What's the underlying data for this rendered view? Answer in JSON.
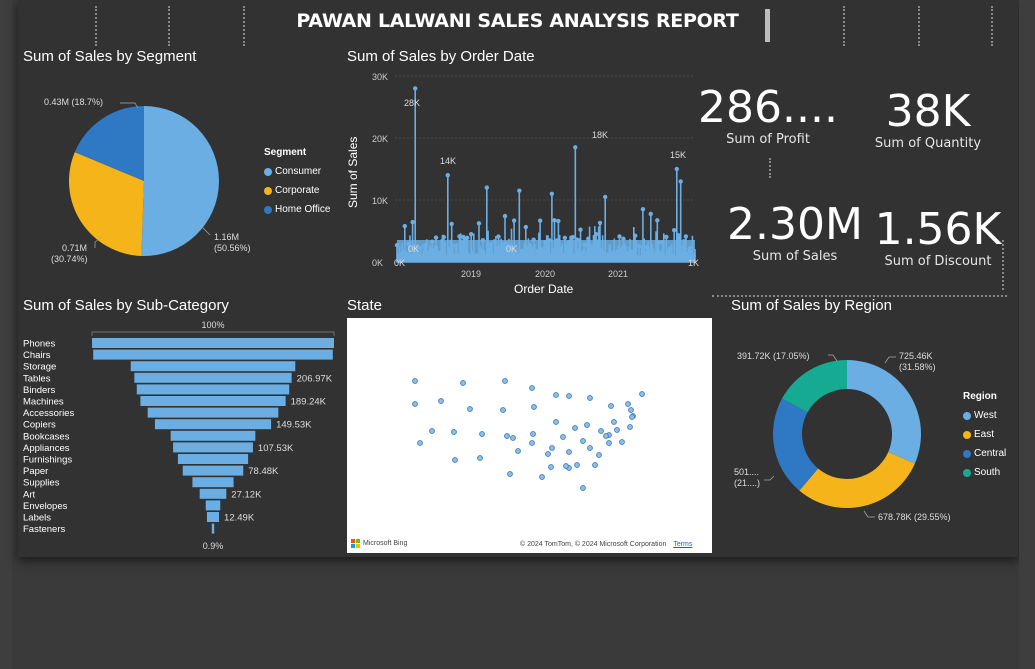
{
  "report": {
    "title": "PAWAN LALWANI SALES ANALYSIS REPORT"
  },
  "colors": {
    "west": "#6aaee3",
    "east": "#f5b51a",
    "central": "#2f78c4",
    "south": "#16aa93",
    "bar": "#6aaee3"
  },
  "segment_chart": {
    "title": "Sum of Sales by Segment",
    "legend_title": "Segment",
    "slices": [
      {
        "name": "Consumer",
        "label": "1.16M (50.56%)",
        "value": 50.56,
        "color": "#6aaee3"
      },
      {
        "name": "Corporate",
        "label": "0.71M (30.74%)",
        "value": 30.74,
        "color": "#f5b51a"
      },
      {
        "name": "Home Office",
        "label": "0.43M (18.7%)",
        "value": 18.7,
        "color": "#2f78c4"
      }
    ],
    "labels": {
      "home_office": "0.43M (18.7%)",
      "corporate_1": "0.71M",
      "corporate_2": "(30.74%)",
      "consumer_1": "1.16M",
      "consumer_2": "(50.56%)"
    }
  },
  "order_date_chart": {
    "title": "Sum of Sales by Order Date",
    "xlabel": "Order Date",
    "ylabel": "Sum of Sales",
    "yticks": [
      "30K",
      "20K",
      "10K",
      "0K"
    ],
    "xticks": [
      "2019",
      "2020",
      "2021"
    ],
    "annotations": [
      "28K",
      "18K",
      "14K",
      "15K",
      "0K",
      "0K",
      "0K",
      "1K"
    ]
  },
  "cards": {
    "profit": {
      "value": "286....",
      "label": "Sum of Profit"
    },
    "quantity": {
      "value": "38K",
      "label": "Sum of Quantity"
    },
    "sales": {
      "value": "2.30M",
      "label": "Sum of Sales"
    },
    "discount": {
      "value": "1.56K",
      "label": "Sum of Discount"
    }
  },
  "subcategory_chart": {
    "title": "Sum of Sales by Sub-Category",
    "top_label": "100%",
    "bottom_label": "0.9%",
    "categories": [
      "Phones",
      "Chairs",
      "Storage",
      "Tables",
      "Binders",
      "Machines",
      "Accessories",
      "Copiers",
      "Bookcases",
      "Appliances",
      "Furnishings",
      "Paper",
      "Supplies",
      "Art",
      "Envelopes",
      "Labels",
      "Fasteners"
    ],
    "values": [
      100,
      99,
      68,
      65,
      63,
      60,
      54,
      48,
      35,
      33,
      29,
      25,
      17,
      11,
      6,
      5,
      1
    ],
    "value_labels": [
      "",
      "",
      "",
      "206.97K",
      "",
      "189.24K",
      "",
      "149.53K",
      "",
      "107.53K",
      "",
      "78.48K",
      "",
      "27.12K",
      "",
      "12.49K",
      ""
    ]
  },
  "state_map": {
    "title": "State",
    "credit_left": "Microsoft Bing",
    "credit_right": "© 2024 TomTom, © 2024 Microsoft Corporation",
    "terms": "Terms"
  },
  "region_chart": {
    "title": "Sum of Sales by Region",
    "legend_title": "Region",
    "slices": [
      {
        "name": "West",
        "label": "725.46K (31.58%)",
        "value": 31.58,
        "color": "#6aaee3"
      },
      {
        "name": "East",
        "label": "678.78K (29.55%)",
        "value": 29.55,
        "color": "#f5b51a"
      },
      {
        "name": "Central",
        "label": "501.... (21....)",
        "value": 21.84,
        "color": "#2f78c4"
      },
      {
        "name": "South",
        "label": "391.72K (17.05%)",
        "value": 17.05,
        "color": "#16aa93"
      }
    ],
    "labels": {
      "west_1": "725.46K",
      "west_2": "(31.58%)",
      "east": "678.78K (29.55%)",
      "central_1": "501....",
      "central_2": "(21....)",
      "south": "391.72K (17.05%)"
    }
  }
}
